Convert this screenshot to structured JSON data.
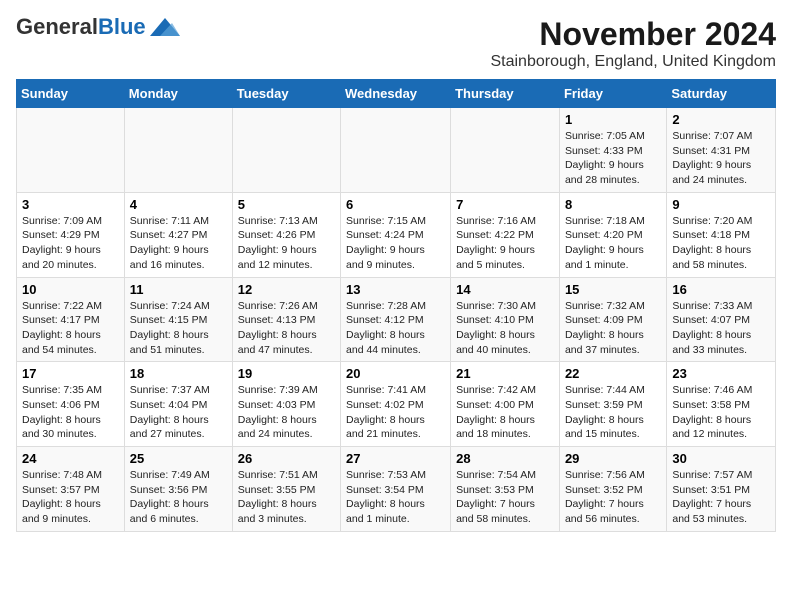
{
  "logo": {
    "general": "General",
    "blue": "Blue"
  },
  "title": "November 2024",
  "subtitle": "Stainborough, England, United Kingdom",
  "days_of_week": [
    "Sunday",
    "Monday",
    "Tuesday",
    "Wednesday",
    "Thursday",
    "Friday",
    "Saturday"
  ],
  "weeks": [
    [
      {
        "day": "",
        "info": ""
      },
      {
        "day": "",
        "info": ""
      },
      {
        "day": "",
        "info": ""
      },
      {
        "day": "",
        "info": ""
      },
      {
        "day": "",
        "info": ""
      },
      {
        "day": "1",
        "info": "Sunrise: 7:05 AM\nSunset: 4:33 PM\nDaylight: 9 hours and 28 minutes."
      },
      {
        "day": "2",
        "info": "Sunrise: 7:07 AM\nSunset: 4:31 PM\nDaylight: 9 hours and 24 minutes."
      }
    ],
    [
      {
        "day": "3",
        "info": "Sunrise: 7:09 AM\nSunset: 4:29 PM\nDaylight: 9 hours and 20 minutes."
      },
      {
        "day": "4",
        "info": "Sunrise: 7:11 AM\nSunset: 4:27 PM\nDaylight: 9 hours and 16 minutes."
      },
      {
        "day": "5",
        "info": "Sunrise: 7:13 AM\nSunset: 4:26 PM\nDaylight: 9 hours and 12 minutes."
      },
      {
        "day": "6",
        "info": "Sunrise: 7:15 AM\nSunset: 4:24 PM\nDaylight: 9 hours and 9 minutes."
      },
      {
        "day": "7",
        "info": "Sunrise: 7:16 AM\nSunset: 4:22 PM\nDaylight: 9 hours and 5 minutes."
      },
      {
        "day": "8",
        "info": "Sunrise: 7:18 AM\nSunset: 4:20 PM\nDaylight: 9 hours and 1 minute."
      },
      {
        "day": "9",
        "info": "Sunrise: 7:20 AM\nSunset: 4:18 PM\nDaylight: 8 hours and 58 minutes."
      }
    ],
    [
      {
        "day": "10",
        "info": "Sunrise: 7:22 AM\nSunset: 4:17 PM\nDaylight: 8 hours and 54 minutes."
      },
      {
        "day": "11",
        "info": "Sunrise: 7:24 AM\nSunset: 4:15 PM\nDaylight: 8 hours and 51 minutes."
      },
      {
        "day": "12",
        "info": "Sunrise: 7:26 AM\nSunset: 4:13 PM\nDaylight: 8 hours and 47 minutes."
      },
      {
        "day": "13",
        "info": "Sunrise: 7:28 AM\nSunset: 4:12 PM\nDaylight: 8 hours and 44 minutes."
      },
      {
        "day": "14",
        "info": "Sunrise: 7:30 AM\nSunset: 4:10 PM\nDaylight: 8 hours and 40 minutes."
      },
      {
        "day": "15",
        "info": "Sunrise: 7:32 AM\nSunset: 4:09 PM\nDaylight: 8 hours and 37 minutes."
      },
      {
        "day": "16",
        "info": "Sunrise: 7:33 AM\nSunset: 4:07 PM\nDaylight: 8 hours and 33 minutes."
      }
    ],
    [
      {
        "day": "17",
        "info": "Sunrise: 7:35 AM\nSunset: 4:06 PM\nDaylight: 8 hours and 30 minutes."
      },
      {
        "day": "18",
        "info": "Sunrise: 7:37 AM\nSunset: 4:04 PM\nDaylight: 8 hours and 27 minutes."
      },
      {
        "day": "19",
        "info": "Sunrise: 7:39 AM\nSunset: 4:03 PM\nDaylight: 8 hours and 24 minutes."
      },
      {
        "day": "20",
        "info": "Sunrise: 7:41 AM\nSunset: 4:02 PM\nDaylight: 8 hours and 21 minutes."
      },
      {
        "day": "21",
        "info": "Sunrise: 7:42 AM\nSunset: 4:00 PM\nDaylight: 8 hours and 18 minutes."
      },
      {
        "day": "22",
        "info": "Sunrise: 7:44 AM\nSunset: 3:59 PM\nDaylight: 8 hours and 15 minutes."
      },
      {
        "day": "23",
        "info": "Sunrise: 7:46 AM\nSunset: 3:58 PM\nDaylight: 8 hours and 12 minutes."
      }
    ],
    [
      {
        "day": "24",
        "info": "Sunrise: 7:48 AM\nSunset: 3:57 PM\nDaylight: 8 hours and 9 minutes."
      },
      {
        "day": "25",
        "info": "Sunrise: 7:49 AM\nSunset: 3:56 PM\nDaylight: 8 hours and 6 minutes."
      },
      {
        "day": "26",
        "info": "Sunrise: 7:51 AM\nSunset: 3:55 PM\nDaylight: 8 hours and 3 minutes."
      },
      {
        "day": "27",
        "info": "Sunrise: 7:53 AM\nSunset: 3:54 PM\nDaylight: 8 hours and 1 minute."
      },
      {
        "day": "28",
        "info": "Sunrise: 7:54 AM\nSunset: 3:53 PM\nDaylight: 7 hours and 58 minutes."
      },
      {
        "day": "29",
        "info": "Sunrise: 7:56 AM\nSunset: 3:52 PM\nDaylight: 7 hours and 56 minutes."
      },
      {
        "day": "30",
        "info": "Sunrise: 7:57 AM\nSunset: 3:51 PM\nDaylight: 7 hours and 53 minutes."
      }
    ]
  ]
}
